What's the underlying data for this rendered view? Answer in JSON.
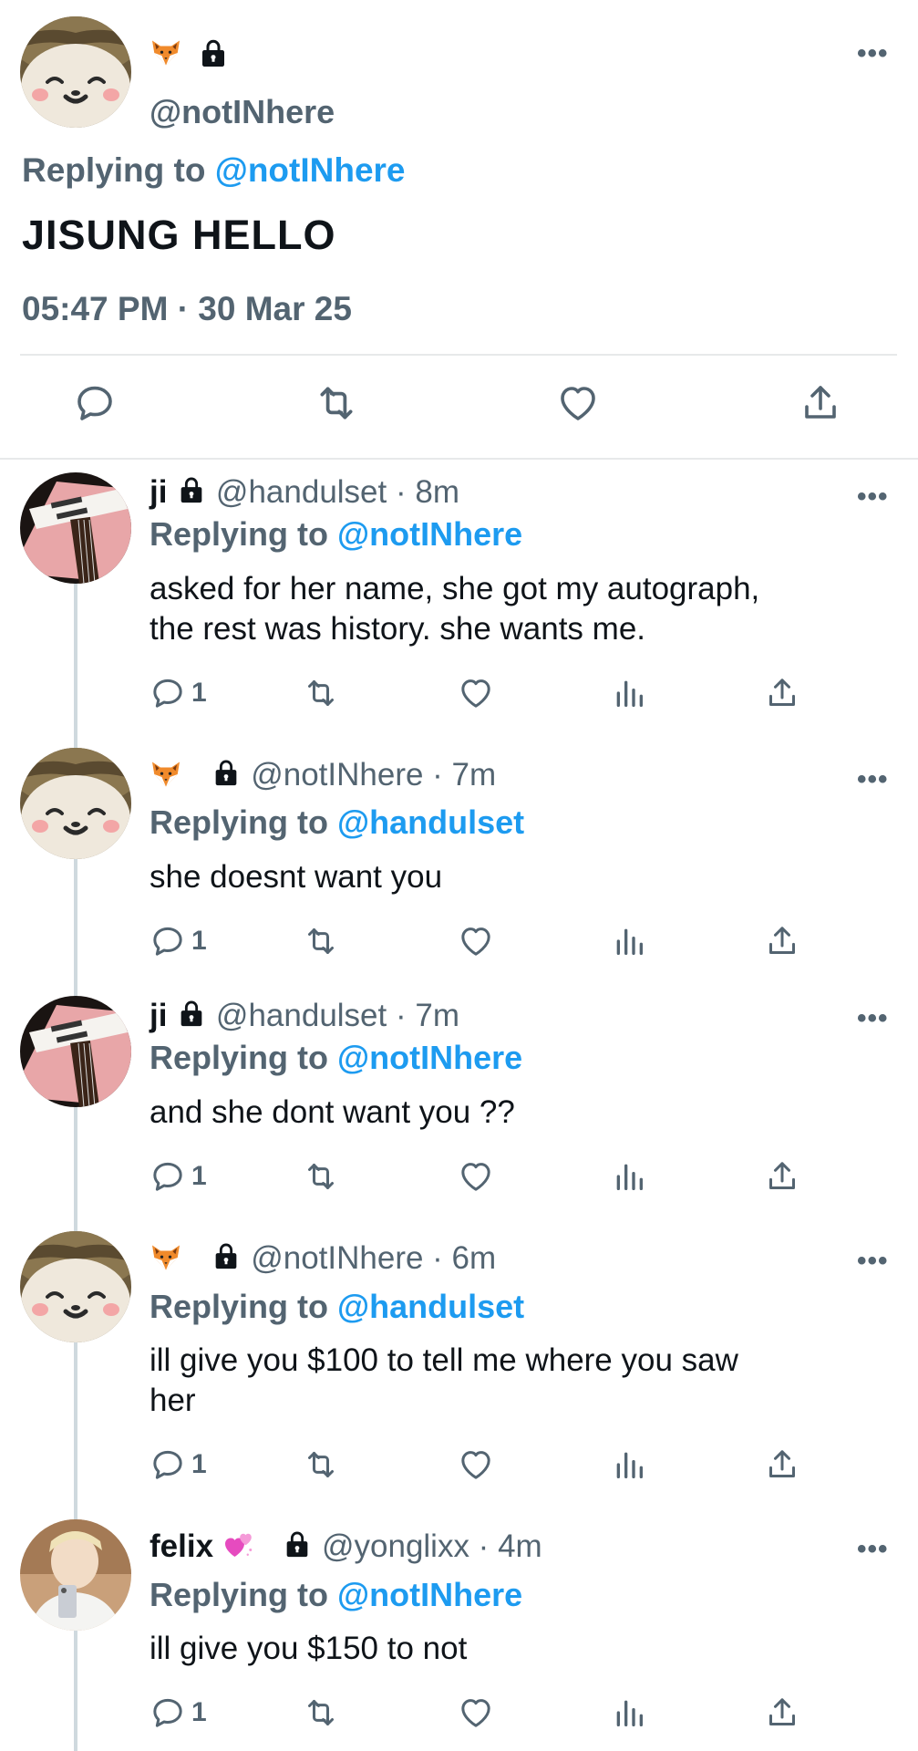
{
  "main_tweet": {
    "handle": "@notINhere",
    "replying_prefix": "Replying to ",
    "replying_to": "@notINhere",
    "text": "JISUNG HELLO",
    "timestamp": "05:47 PM · 30 Mar 25"
  },
  "replies": [
    {
      "display_name": "ji",
      "handle_time": "@handulset · 8m",
      "replying_prefix": "Replying to ",
      "replying_to": "@notINhere",
      "text_line1": "asked for her name, she got my autograph,",
      "text_line2": "the rest was history. she wants me.",
      "reply_count": "1"
    },
    {
      "display_name": "",
      "handle_time": "@notINhere · 7m",
      "replying_prefix": "Replying to ",
      "replying_to": "@handulset",
      "text_line1": "she doesnt want you",
      "reply_count": "1"
    },
    {
      "display_name": "ji",
      "handle_time": "@handulset · 7m",
      "replying_prefix": "Replying to ",
      "replying_to": "@notINhere",
      "text_line1": "and she dont want you ??",
      "reply_count": "1"
    },
    {
      "display_name": "",
      "handle_time": "@notINhere · 6m",
      "replying_prefix": "Replying to ",
      "replying_to": "@handulset",
      "text_line1": "ill give you $100 to tell me where you saw",
      "text_line2": "her",
      "reply_count": "1"
    },
    {
      "display_name": "felix",
      "handle_time": "@yonglixx · 4m",
      "replying_prefix": "Replying to ",
      "replying_to": "@notINhere",
      "text_line1": "ill give you $150 to not",
      "reply_count": "1"
    }
  ],
  "colors": {
    "link": "#1d9bf0",
    "secondary_text": "#536471",
    "primary_text": "#0f1419",
    "divider": "#eff3f4"
  },
  "icons": {
    "reply": "reply-icon",
    "retweet": "retweet-icon",
    "like": "heart-icon",
    "views": "views-icon",
    "share": "share-icon",
    "more": "more-icon",
    "lock": "lock-icon",
    "fox": "fox-icon",
    "hearts": "hearts-icon"
  }
}
